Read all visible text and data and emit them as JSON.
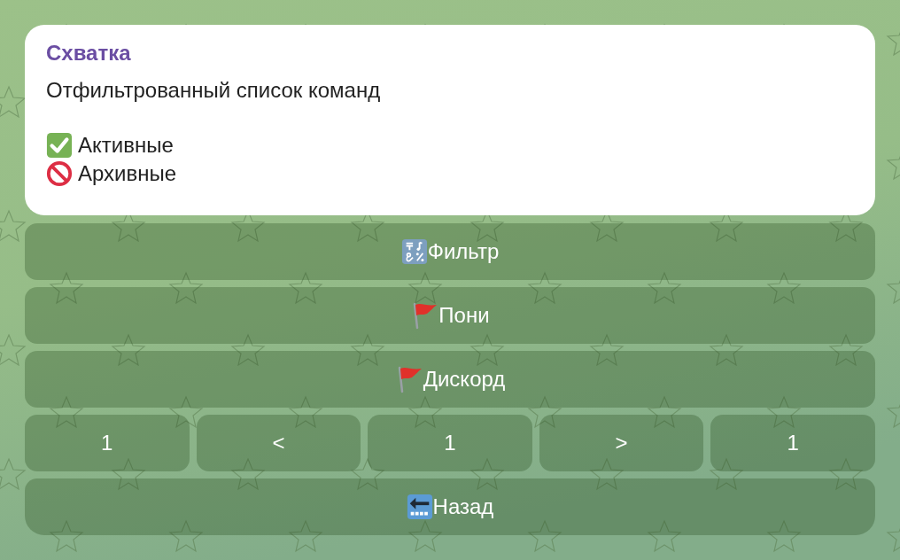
{
  "message": {
    "sender": "Схватка",
    "text": "Отфильтрованный список команд",
    "legend": [
      {
        "kind": "check",
        "label": "Активные"
      },
      {
        "kind": "blocked",
        "label": "Архивные"
      }
    ]
  },
  "keyboard": {
    "rows": [
      {
        "buttons": [
          {
            "kind": "symbols",
            "label": "Фильтр"
          }
        ]
      },
      {
        "buttons": [
          {
            "kind": "flag",
            "label": "Пони"
          }
        ]
      },
      {
        "buttons": [
          {
            "kind": "flag",
            "label": "Дискорд"
          }
        ]
      },
      {
        "buttons": [
          {
            "kind": "plain",
            "label": "1"
          },
          {
            "kind": "plain",
            "label": "<"
          },
          {
            "kind": "plain",
            "label": "1"
          },
          {
            "kind": "plain",
            "label": ">"
          },
          {
            "kind": "plain",
            "label": "1"
          }
        ]
      },
      {
        "buttons": [
          {
            "kind": "back",
            "label": "Назад"
          }
        ]
      }
    ]
  }
}
